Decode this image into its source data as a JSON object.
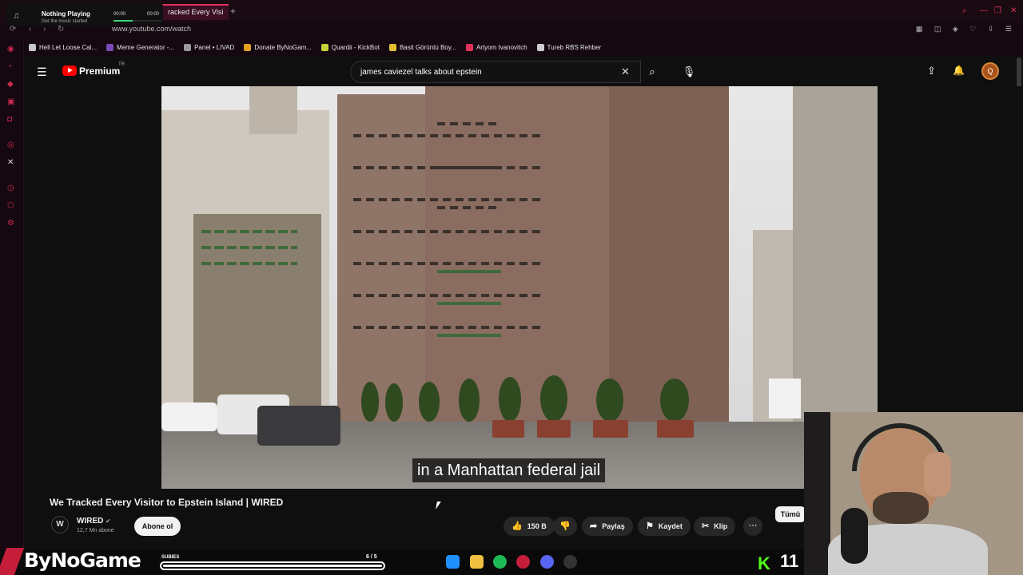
{
  "browser": {
    "active_tab_title": "racked Every Visi",
    "url": "www.youtube.com/watch",
    "accent_color": "#e0315b",
    "bookmarks": [
      {
        "label": "Hell Let Loose Cal...",
        "color": "#c8c8c8"
      },
      {
        "label": "Meme Generator -...",
        "color": "#7a4ab8"
      },
      {
        "label": "Panel • LIVAD",
        "color": "#9a9a9a"
      },
      {
        "label": "Donate ByNoGam...",
        "color": "#e0a020"
      },
      {
        "label": "Quardii - KickBot",
        "color": "#c8d23a"
      },
      {
        "label": "Basit Görüntü Boy...",
        "color": "#e0c030"
      },
      {
        "label": "Artyom Ivanovitch",
        "color": "#e0315b"
      },
      {
        "label": "Tureb RBS Rehber",
        "color": "#cfcfcf"
      }
    ]
  },
  "music_widget": {
    "title": "Nothing Playing",
    "subtitle": "Get the music started",
    "time_start": "00:00",
    "time_end": "00:00",
    "progress": 0.4
  },
  "youtube": {
    "brand": "Premium",
    "region": "TR",
    "search_query": "james caviezel talks about epstein",
    "avatar_letter": "Q"
  },
  "video": {
    "caption": "in a Manhattan federal jail",
    "title": "We Tracked Every Visitor to Epstein Island | WIRED",
    "channel_name": "WIRED",
    "channel_subs": "12,7 Mn abone",
    "subscribe_label": "Abone ol",
    "likes": "150 B",
    "share_label": "Paylaş",
    "save_label": "Kaydet",
    "clip_label": "Klip",
    "all_label": "Tümü"
  },
  "overlay": {
    "brand": "ByNoGame",
    "subgoal_label": "SUBIES",
    "subgoal_count": "6 / 5",
    "subgoal_progress": 1.0,
    "kick_viewers": "11",
    "kick_color": "#53fc18"
  }
}
